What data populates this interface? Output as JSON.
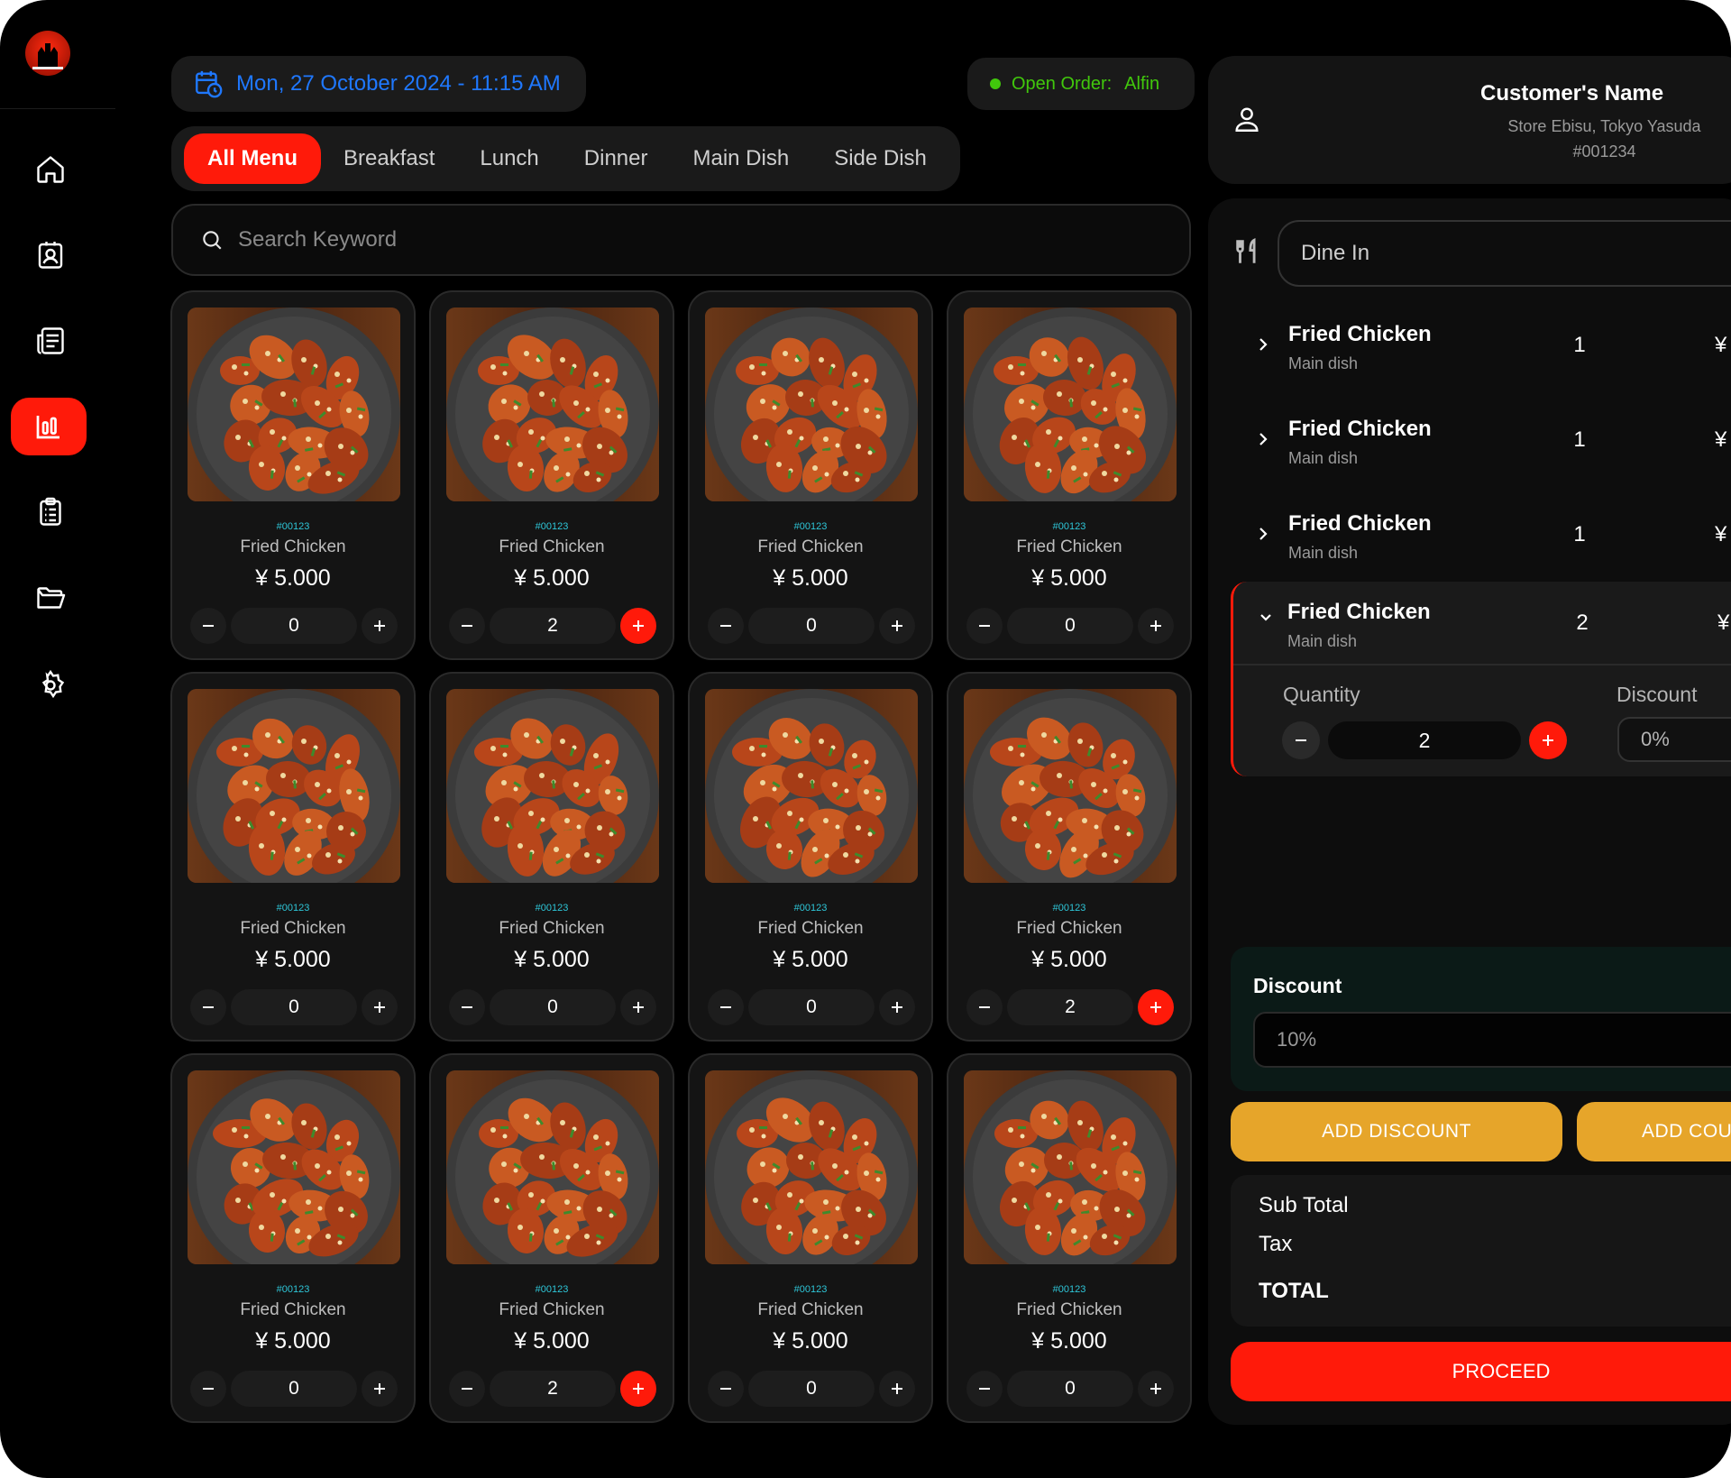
{
  "header": {
    "date": "Mon, 27 October 2024 - 11:15 AM",
    "open_order_label": "Open Order:",
    "open_order_name": "Alfin"
  },
  "tabs": [
    {
      "label": "All Menu"
    },
    {
      "label": "Breakfast"
    },
    {
      "label": "Lunch"
    },
    {
      "label": "Dinner"
    },
    {
      "label": "Main Dish"
    },
    {
      "label": "Side Dish"
    }
  ],
  "search": {
    "placeholder": "Search Keyword"
  },
  "menu": [
    {
      "code": "#00123",
      "name": "Fried Chicken",
      "price": "¥ 5.000",
      "qty": "0"
    },
    {
      "code": "#00123",
      "name": "Fried Chicken",
      "price": "¥ 5.000",
      "qty": "2"
    },
    {
      "code": "#00123",
      "name": "Fried Chicken",
      "price": "¥ 5.000",
      "qty": "0"
    },
    {
      "code": "#00123",
      "name": "Fried Chicken",
      "price": "¥ 5.000",
      "qty": "0"
    },
    {
      "code": "#00123",
      "name": "Fried Chicken",
      "price": "¥ 5.000",
      "qty": "0"
    },
    {
      "code": "#00123",
      "name": "Fried Chicken",
      "price": "¥ 5.000",
      "qty": "0"
    },
    {
      "code": "#00123",
      "name": "Fried Chicken",
      "price": "¥ 5.000",
      "qty": "0"
    },
    {
      "code": "#00123",
      "name": "Fried Chicken",
      "price": "¥ 5.000",
      "qty": "2"
    },
    {
      "code": "#00123",
      "name": "Fried Chicken",
      "price": "¥ 5.000",
      "qty": "0"
    },
    {
      "code": "#00123",
      "name": "Fried Chicken",
      "price": "¥ 5.000",
      "qty": "2"
    },
    {
      "code": "#00123",
      "name": "Fried Chicken",
      "price": "¥ 5.000",
      "qty": "0"
    },
    {
      "code": "#00123",
      "name": "Fried Chicken",
      "price": "¥ 5.000",
      "qty": "0"
    }
  ],
  "customer": {
    "name": "Customer's Name",
    "store": "Store Ebisu, Tokyo Yasuda",
    "id": "#001234"
  },
  "order": {
    "type": "Dine In",
    "items": [
      {
        "name": "Fried Chicken",
        "category": "Main dish",
        "qty": "1",
        "currency": "¥"
      },
      {
        "name": "Fried Chicken",
        "category": "Main dish",
        "qty": "1",
        "currency": "¥"
      },
      {
        "name": "Fried Chicken",
        "category": "Main dish",
        "qty": "1",
        "currency": "¥"
      },
      {
        "name": "Fried Chicken",
        "category": "Main dish",
        "qty": "2",
        "currency": "¥"
      }
    ],
    "expanded": {
      "quantity_label": "Quantity",
      "quantity_value": "2",
      "discount_label": "Discount",
      "discount_value": "0%"
    }
  },
  "discount": {
    "title": "Discount",
    "value": "10%",
    "add_discount_label": "ADD DISCOUNT",
    "add_coupon_label": "ADD COU"
  },
  "totals": {
    "subtotal_label": "Sub Total",
    "tax_label": "Tax",
    "total_label": "TOTAL"
  },
  "proceed_label": "PROCEED",
  "colors": {
    "accent": "#ff1a0a",
    "date_blue": "#1f78ff",
    "open_green": "#41c80c",
    "code_cyan": "#2ec6d8",
    "discount_yellow": "#e6a52a"
  }
}
